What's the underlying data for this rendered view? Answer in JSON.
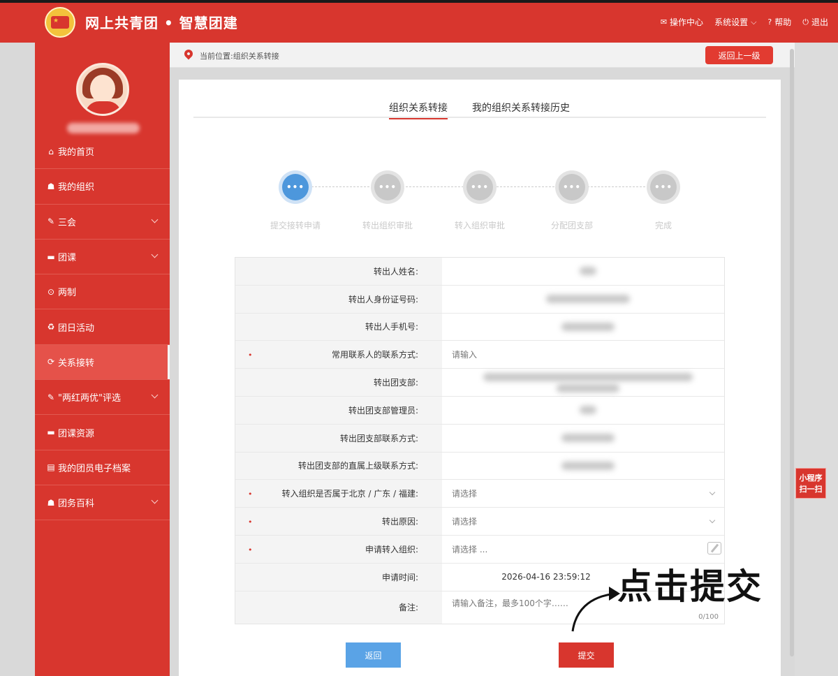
{
  "header": {
    "title": "网上共青团 • 智慧团建",
    "nav": [
      {
        "icon": "mail-icon",
        "label": "操作中心"
      },
      {
        "icon": "settings-dropdown",
        "label": "系统设置"
      },
      {
        "icon": "help-icon",
        "label": "帮助"
      },
      {
        "icon": "power-icon",
        "label": "退出"
      }
    ]
  },
  "sidebar": {
    "items": [
      {
        "icon": "home-icon",
        "label": "我的首页",
        "expand": false
      },
      {
        "icon": "group-icon",
        "label": "我的组织",
        "expand": false
      },
      {
        "icon": "edit-icon",
        "label": "三会",
        "expand": true
      },
      {
        "icon": "folder-icon",
        "label": "团课",
        "expand": true
      },
      {
        "icon": "circle-icon",
        "label": "两制",
        "expand": false
      },
      {
        "icon": "recycle-icon",
        "label": "团日活动",
        "expand": false
      },
      {
        "icon": "refresh-icon",
        "label": "关系接转",
        "expand": false,
        "active": true
      },
      {
        "icon": "edit-icon",
        "label": "\"两红两优\"评选",
        "expand": true
      },
      {
        "icon": "folder-icon",
        "label": "团课资源",
        "expand": false
      },
      {
        "icon": "file-icon",
        "label": "我的团员电子档案",
        "expand": false
      },
      {
        "icon": "group-icon",
        "label": "团务百科",
        "expand": true
      }
    ]
  },
  "breadcrumb": {
    "text": "当前位置:组织关系转接",
    "back_button": "返回上一级"
  },
  "tabs": [
    "组织关系转接",
    "我的组织关系转接历史"
  ],
  "steps": {
    "current": 0,
    "icon_text": "•••",
    "labels": [
      "提交接转申请",
      "转出组织审批",
      "转入组织审批",
      "分配团支部",
      "完成"
    ]
  },
  "form": {
    "rows": [
      {
        "label": "转出人姓名:",
        "required": false,
        "type": "blur"
      },
      {
        "label": "转出人身份证号码:",
        "required": false,
        "type": "blur"
      },
      {
        "label": "转出人手机号:",
        "required": false,
        "type": "blur"
      },
      {
        "label": "常用联系人的联系方式:",
        "required": true,
        "type": "input",
        "placeholder": "请输入"
      },
      {
        "label": "转出团支部:",
        "required": false,
        "type": "blur"
      },
      {
        "label": "转出团支部管理员:",
        "required": false,
        "type": "blur"
      },
      {
        "label": "转出团支部联系方式:",
        "required": false,
        "type": "blur"
      },
      {
        "label": "转出团支部的直属上级联系方式:",
        "required": false,
        "type": "blur"
      },
      {
        "label": "转入组织是否属于北京 / 广东 / 福建:",
        "required": true,
        "type": "select",
        "placeholder": "请选择"
      },
      {
        "label": "转出原因:",
        "required": true,
        "type": "select",
        "placeholder": "请选择"
      },
      {
        "label": "申请转入组织:",
        "required": true,
        "type": "picker",
        "placeholder": "请选择 ..."
      },
      {
        "label": "申请时间:",
        "required": false,
        "type": "text",
        "value": "2026-04-16 23:59:12"
      },
      {
        "label": "备注:",
        "required": false,
        "type": "textarea",
        "placeholder": "请输入备注，最多100个字……",
        "counter": "0/100"
      }
    ],
    "required_mark": "•"
  },
  "buttons": {
    "back": "返回",
    "submit": "提交"
  },
  "annotation": "点击提交",
  "float": {
    "line1": "小程序",
    "line2": "扫一扫"
  },
  "colors": {
    "brand": "#d8362e",
    "step_current": "#4d97dc",
    "back_button": "#5aa3e6"
  }
}
